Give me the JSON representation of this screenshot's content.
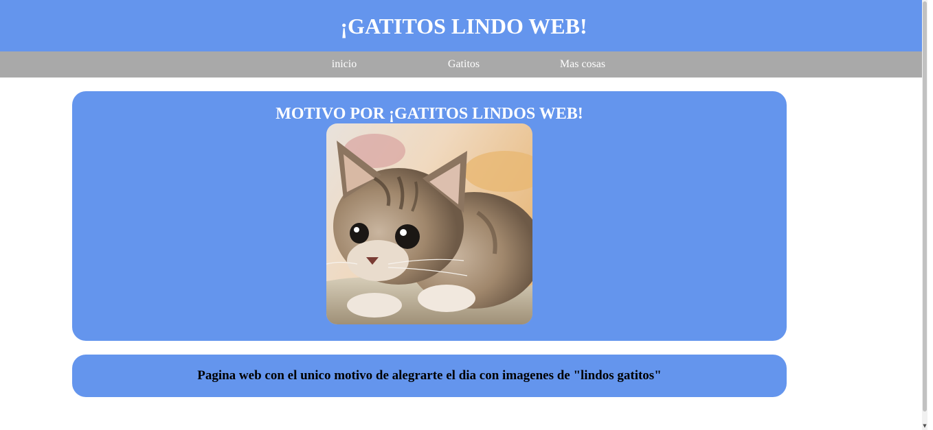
{
  "header": {
    "title": "¡GATITOS LINDO WEB!"
  },
  "nav": {
    "items": [
      "inicio",
      "Gatitos",
      "Mas cosas"
    ]
  },
  "main_card": {
    "heading": "MOTIVO POR ¡GATITOS LINDOS WEB!",
    "image": "kitten-photo"
  },
  "description": {
    "text": "Pagina web con el unico motivo de alegrarte el dia con imagenes de \"lindos gatitos\""
  },
  "scrollbar": {
    "arrow_icon": "chevron-down-icon"
  },
  "colors": {
    "accent": "#6495ed",
    "nav_bg": "#a9a9a9",
    "text_light": "#ffffff"
  }
}
